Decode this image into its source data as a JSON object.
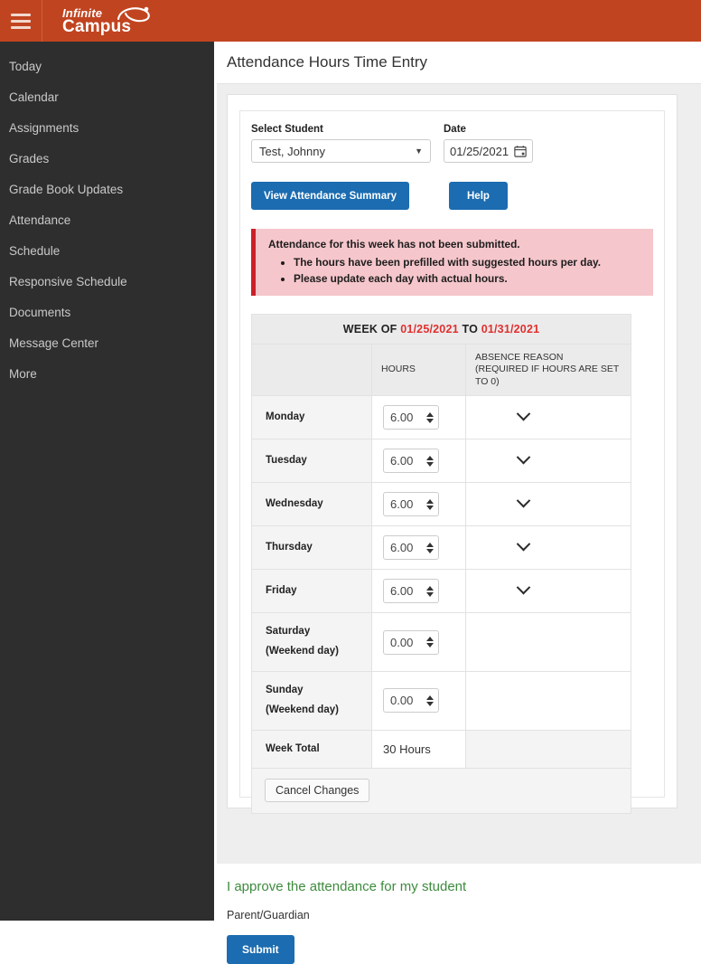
{
  "topbar": {
    "menu_icon": "hamburger-icon",
    "brand_line1": "Infinite",
    "brand_line2": "Campus",
    "bar_color": "#c14420"
  },
  "sidebar": {
    "items": [
      {
        "label": "Today"
      },
      {
        "label": "Calendar"
      },
      {
        "label": "Assignments"
      },
      {
        "label": "Grades"
      },
      {
        "label": "Grade Book Updates"
      },
      {
        "label": "Attendance"
      },
      {
        "label": "Schedule"
      },
      {
        "label": "Responsive Schedule"
      },
      {
        "label": "Documents"
      },
      {
        "label": "Message Center"
      },
      {
        "label": "More"
      }
    ]
  },
  "header": {
    "title": "Attendance Hours Time Entry"
  },
  "form": {
    "student_label": "Select Student",
    "student_value": "Test, Johnny",
    "date_label": "Date",
    "date_value": "01/25/2021",
    "calendar_icon": "calendar-icon",
    "view_summary_label": "View Attendance Summary",
    "help_label": "Help",
    "button_color": "#1b6cb0"
  },
  "alert": {
    "heading": "Attendance for this week has not been submitted.",
    "bullets": [
      "The hours have been prefilled with suggested hours per day.",
      "Please update each day with actual hours."
    ],
    "bg_color": "#f5c6cb",
    "accent_color": "#cc2028"
  },
  "table": {
    "week_of_prefix": "WEEK OF",
    "week_start": "01/25/2021",
    "week_to": "TO",
    "week_end": "01/31/2021",
    "week_date_color": "#e03030",
    "col_blank": "",
    "col_hours": "HOURS",
    "col_reason_line1": "ABSENCE REASON",
    "col_reason_line2": "(REQUIRED IF HOURS ARE SET TO 0)",
    "rows": [
      {
        "day": "Monday",
        "sub": "",
        "hours": "6.00",
        "has_reason": true
      },
      {
        "day": "Tuesday",
        "sub": "",
        "hours": "6.00",
        "has_reason": true
      },
      {
        "day": "Wednesday",
        "sub": "",
        "hours": "6.00",
        "has_reason": true
      },
      {
        "day": "Thursday",
        "sub": "",
        "hours": "6.00",
        "has_reason": true
      },
      {
        "day": "Friday",
        "sub": "",
        "hours": "6.00",
        "has_reason": true
      },
      {
        "day": "Saturday",
        "sub": "(Weekend day)",
        "hours": "0.00",
        "has_reason": false
      },
      {
        "day": "Sunday",
        "sub": "(Weekend day)",
        "hours": "0.00",
        "has_reason": false
      }
    ],
    "total_label": "Week Total",
    "total_value": "30 Hours",
    "cancel_label": "Cancel Changes"
  },
  "footer": {
    "approve_text": "I approve the attendance for my student",
    "approve_color": "#3d8b3d",
    "role_label": "Parent/Guardian",
    "submit_label": "Submit"
  }
}
